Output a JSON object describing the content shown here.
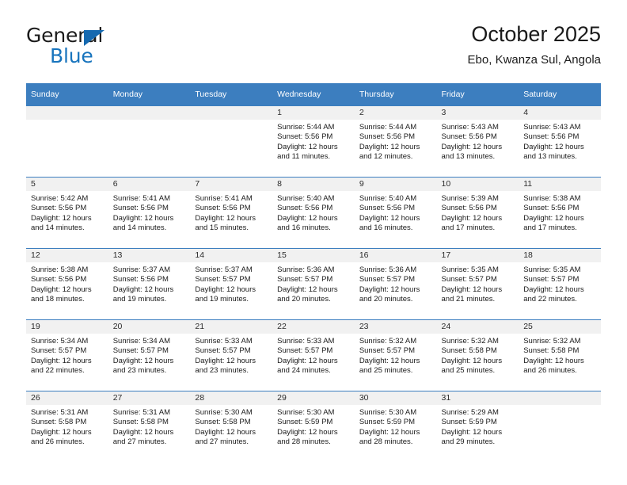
{
  "logo": {
    "line1": "General",
    "line2": "Blue",
    "triangle_color": "#1569b0",
    "blue_color": "#1874bd"
  },
  "header": {
    "title": "October 2025",
    "subtitle": "Ebo, Kwanza Sul, Angola"
  },
  "theme": {
    "accent": "#3c7ebf",
    "day_band": "#f1f1f1",
    "text": "#1b1b1b"
  },
  "calendar": {
    "weekdays": [
      "Sunday",
      "Monday",
      "Tuesday",
      "Wednesday",
      "Thursday",
      "Friday",
      "Saturday"
    ],
    "labels": {
      "sunrise": "Sunrise:",
      "sunset": "Sunset:",
      "daylight": "Daylight:"
    },
    "weeks": [
      [
        {
          "day": ""
        },
        {
          "day": ""
        },
        {
          "day": ""
        },
        {
          "day": "1",
          "sunrise": "Sunrise: 5:44 AM",
          "sunset": "Sunset: 5:56 PM",
          "daylight": "Daylight: 12 hours and 11 minutes."
        },
        {
          "day": "2",
          "sunrise": "Sunrise: 5:44 AM",
          "sunset": "Sunset: 5:56 PM",
          "daylight": "Daylight: 12 hours and 12 minutes."
        },
        {
          "day": "3",
          "sunrise": "Sunrise: 5:43 AM",
          "sunset": "Sunset: 5:56 PM",
          "daylight": "Daylight: 12 hours and 13 minutes."
        },
        {
          "day": "4",
          "sunrise": "Sunrise: 5:43 AM",
          "sunset": "Sunset: 5:56 PM",
          "daylight": "Daylight: 12 hours and 13 minutes."
        }
      ],
      [
        {
          "day": "5",
          "sunrise": "Sunrise: 5:42 AM",
          "sunset": "Sunset: 5:56 PM",
          "daylight": "Daylight: 12 hours and 14 minutes."
        },
        {
          "day": "6",
          "sunrise": "Sunrise: 5:41 AM",
          "sunset": "Sunset: 5:56 PM",
          "daylight": "Daylight: 12 hours and 14 minutes."
        },
        {
          "day": "7",
          "sunrise": "Sunrise: 5:41 AM",
          "sunset": "Sunset: 5:56 PM",
          "daylight": "Daylight: 12 hours and 15 minutes."
        },
        {
          "day": "8",
          "sunrise": "Sunrise: 5:40 AM",
          "sunset": "Sunset: 5:56 PM",
          "daylight": "Daylight: 12 hours and 16 minutes."
        },
        {
          "day": "9",
          "sunrise": "Sunrise: 5:40 AM",
          "sunset": "Sunset: 5:56 PM",
          "daylight": "Daylight: 12 hours and 16 minutes."
        },
        {
          "day": "10",
          "sunrise": "Sunrise: 5:39 AM",
          "sunset": "Sunset: 5:56 PM",
          "daylight": "Daylight: 12 hours and 17 minutes."
        },
        {
          "day": "11",
          "sunrise": "Sunrise: 5:38 AM",
          "sunset": "Sunset: 5:56 PM",
          "daylight": "Daylight: 12 hours and 17 minutes."
        }
      ],
      [
        {
          "day": "12",
          "sunrise": "Sunrise: 5:38 AM",
          "sunset": "Sunset: 5:56 PM",
          "daylight": "Daylight: 12 hours and 18 minutes."
        },
        {
          "day": "13",
          "sunrise": "Sunrise: 5:37 AM",
          "sunset": "Sunset: 5:56 PM",
          "daylight": "Daylight: 12 hours and 19 minutes."
        },
        {
          "day": "14",
          "sunrise": "Sunrise: 5:37 AM",
          "sunset": "Sunset: 5:57 PM",
          "daylight": "Daylight: 12 hours and 19 minutes."
        },
        {
          "day": "15",
          "sunrise": "Sunrise: 5:36 AM",
          "sunset": "Sunset: 5:57 PM",
          "daylight": "Daylight: 12 hours and 20 minutes."
        },
        {
          "day": "16",
          "sunrise": "Sunrise: 5:36 AM",
          "sunset": "Sunset: 5:57 PM",
          "daylight": "Daylight: 12 hours and 20 minutes."
        },
        {
          "day": "17",
          "sunrise": "Sunrise: 5:35 AM",
          "sunset": "Sunset: 5:57 PM",
          "daylight": "Daylight: 12 hours and 21 minutes."
        },
        {
          "day": "18",
          "sunrise": "Sunrise: 5:35 AM",
          "sunset": "Sunset: 5:57 PM",
          "daylight": "Daylight: 12 hours and 22 minutes."
        }
      ],
      [
        {
          "day": "19",
          "sunrise": "Sunrise: 5:34 AM",
          "sunset": "Sunset: 5:57 PM",
          "daylight": "Daylight: 12 hours and 22 minutes."
        },
        {
          "day": "20",
          "sunrise": "Sunrise: 5:34 AM",
          "sunset": "Sunset: 5:57 PM",
          "daylight": "Daylight: 12 hours and 23 minutes."
        },
        {
          "day": "21",
          "sunrise": "Sunrise: 5:33 AM",
          "sunset": "Sunset: 5:57 PM",
          "daylight": "Daylight: 12 hours and 23 minutes."
        },
        {
          "day": "22",
          "sunrise": "Sunrise: 5:33 AM",
          "sunset": "Sunset: 5:57 PM",
          "daylight": "Daylight: 12 hours and 24 minutes."
        },
        {
          "day": "23",
          "sunrise": "Sunrise: 5:32 AM",
          "sunset": "Sunset: 5:57 PM",
          "daylight": "Daylight: 12 hours and 25 minutes."
        },
        {
          "day": "24",
          "sunrise": "Sunrise: 5:32 AM",
          "sunset": "Sunset: 5:58 PM",
          "daylight": "Daylight: 12 hours and 25 minutes."
        },
        {
          "day": "25",
          "sunrise": "Sunrise: 5:32 AM",
          "sunset": "Sunset: 5:58 PM",
          "daylight": "Daylight: 12 hours and 26 minutes."
        }
      ],
      [
        {
          "day": "26",
          "sunrise": "Sunrise: 5:31 AM",
          "sunset": "Sunset: 5:58 PM",
          "daylight": "Daylight: 12 hours and 26 minutes."
        },
        {
          "day": "27",
          "sunrise": "Sunrise: 5:31 AM",
          "sunset": "Sunset: 5:58 PM",
          "daylight": "Daylight: 12 hours and 27 minutes."
        },
        {
          "day": "28",
          "sunrise": "Sunrise: 5:30 AM",
          "sunset": "Sunset: 5:58 PM",
          "daylight": "Daylight: 12 hours and 27 minutes."
        },
        {
          "day": "29",
          "sunrise": "Sunrise: 5:30 AM",
          "sunset": "Sunset: 5:59 PM",
          "daylight": "Daylight: 12 hours and 28 minutes."
        },
        {
          "day": "30",
          "sunrise": "Sunrise: 5:30 AM",
          "sunset": "Sunset: 5:59 PM",
          "daylight": "Daylight: 12 hours and 28 minutes."
        },
        {
          "day": "31",
          "sunrise": "Sunrise: 5:29 AM",
          "sunset": "Sunset: 5:59 PM",
          "daylight": "Daylight: 12 hours and 29 minutes."
        },
        {
          "day": ""
        }
      ]
    ]
  }
}
